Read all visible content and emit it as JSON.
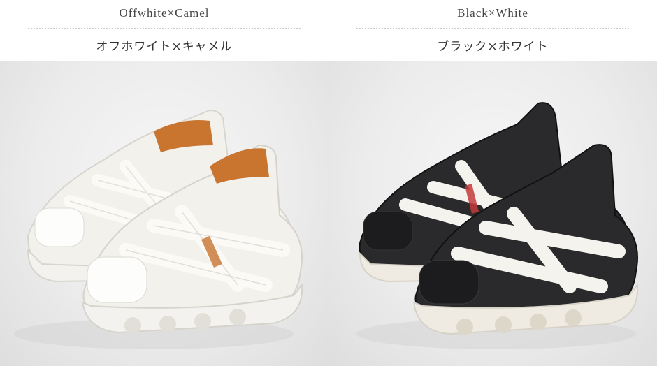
{
  "variants": [
    {
      "name_en": "Offwhite×Camel",
      "name_ja": "オフホワイト×キャメル",
      "upper_color": "#f3f1ec",
      "lining_color": "#c9742f",
      "strap_color": "#fbfaf7",
      "sole_color": "#f4f2ee"
    },
    {
      "name_en": "Black×White",
      "name_ja": "ブラック×ホワイト",
      "upper_color": "#2a2a2c",
      "lining_color": "#1c1c1e",
      "strap_color": "#f5f3ee",
      "sole_color": "#efebe2"
    }
  ]
}
